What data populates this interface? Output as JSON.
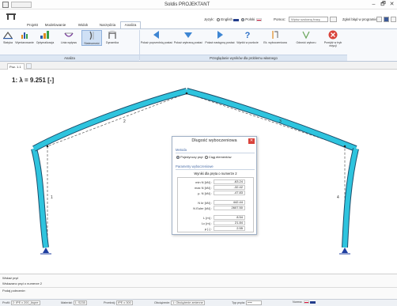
{
  "window": {
    "title": "Soldis PROJEKTANT",
    "minimize": "–",
    "maximize": "🗗",
    "close": "✕"
  },
  "top_bar": {
    "language_label": "Język:",
    "lang_english": "English",
    "lang_polish": "Polski",
    "help_label": "Pomoc:",
    "help_placeholder": "Wpisz szukaną frazę",
    "report_label": "Zgłoś błąd w programie"
  },
  "menu_tabs": [
    "Projekt",
    "Modelowanie",
    "Widok",
    "Narzędzia",
    "Analiza"
  ],
  "active_tab": "Analiza",
  "ribbon": {
    "analysis_buttons": [
      "Statyka",
      "Wymiarowanie",
      "Optymalizacja",
      "Linia wpływu",
      "Stateczność",
      "Dynamika"
    ],
    "view_buttons": [
      "Pokaż poprzednią postać",
      "Pokaż wybraną postać",
      "Pokaż następną postać",
      "Wyniki w punkcie",
      "Ek. wyboczeniowa",
      "Odwróć wyboru",
      "Przejdź w tryb edycji"
    ],
    "group_analysis": "Analiza",
    "group_results": "Przeglądanie wyników dla problemu własnego"
  },
  "document_tab": "Poz. 1.1",
  "canvas": {
    "result_title": "1: λ = 9.251 [-]",
    "member_labels": [
      "1",
      "2",
      "3",
      "4"
    ]
  },
  "dialog": {
    "title": "Długość wyboczeniowa",
    "section_method": "Metoda",
    "option_single": "Pojedynczy pręt",
    "option_chain": "Ciąg elementów",
    "section_params": "Parametry wyboczeniowe",
    "subtitle": "Wyniki dla pręta o numerze 2",
    "rows": [
      {
        "label": "min N [kN] :",
        "value": "-63.24"
      },
      {
        "label": "max N [kN] :",
        "value": "-32.42"
      },
      {
        "label": "μ. N [kN] :",
        "value": "-47.83"
      },
      {
        "label": "N kr [kN] :",
        "value": "442.44"
      },
      {
        "label": "N Euler [kN] :",
        "value": "2607.50"
      },
      {
        "label": "L [m] :",
        "value": "8.54"
      },
      {
        "label": "Lc [m] :",
        "value": "21.84"
      },
      {
        "label": "μ [-] :",
        "value": "2.55"
      }
    ]
  },
  "status": {
    "lines": [
      "Wskaż pręt",
      "Wskazano pręt o numerze 2",
      "Podaj polecenie:"
    ]
  },
  "statusbar": {
    "profile_label": "Profil:",
    "profile_value": "2: IPE x 200_Aspre",
    "material_label": "Materiał:",
    "material_value": "1: S235",
    "przekroj_label": "Przekrój:",
    "przekroj_value": "IPE o 300",
    "load_label": "Obciążenie:",
    "load_value": "1: Obciążenie zmienne",
    "type_label": "Typ pręta:",
    "norm_label": "Norma:"
  },
  "colors": {
    "member_fill": "#2ec4de",
    "member_stroke": "#1c4e6b",
    "support": "#1f3ea0",
    "ribbon_bg": "#f7f9fc",
    "close_red": "#d9433b"
  }
}
